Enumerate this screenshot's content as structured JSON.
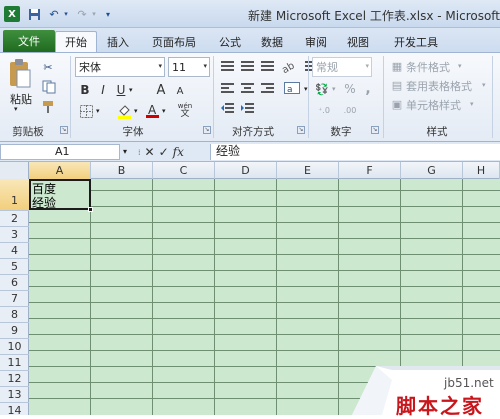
{
  "title": "新建 Microsoft Excel 工作表.xlsx - Microsoft Ex",
  "tabs": [
    "文件",
    "开始",
    "插入",
    "页面布局",
    "公式",
    "数据",
    "审阅",
    "视图",
    "开发工具"
  ],
  "ribbon": {
    "clipboard": {
      "paste": "粘贴",
      "group": "剪贴板"
    },
    "font": {
      "name": "宋体",
      "size": "11",
      "group": "字体",
      "bold": "B",
      "italic": "I",
      "underline": "U",
      "wen": "wén",
      "grow": "A",
      "shrink": "A"
    },
    "align": {
      "group": "对齐方式"
    },
    "number": {
      "format": "常规",
      "group": "数字",
      "pct": "%",
      "comma": ","
    },
    "styles": {
      "cond": "条件格式",
      "table": "套用表格格式",
      "cell": "单元格样式",
      "group": "样式"
    }
  },
  "formula_bar": {
    "namebox": "A1",
    "content": "经验"
  },
  "columns": [
    "A",
    "B",
    "C",
    "D",
    "E",
    "F",
    "G",
    "H"
  ],
  "rows": [
    "1",
    "2",
    "3",
    "4",
    "5",
    "6",
    "7",
    "8",
    "9",
    "10",
    "11",
    "12",
    "13",
    "14"
  ],
  "cell_a1": {
    "line1": "百度",
    "line2": "经验"
  },
  "watermark": {
    "site": "jb51.net",
    "brand": "脚本之家"
  },
  "colors": {
    "accent": "#1f6b1f",
    "cell_bg": "#cce8cf"
  }
}
